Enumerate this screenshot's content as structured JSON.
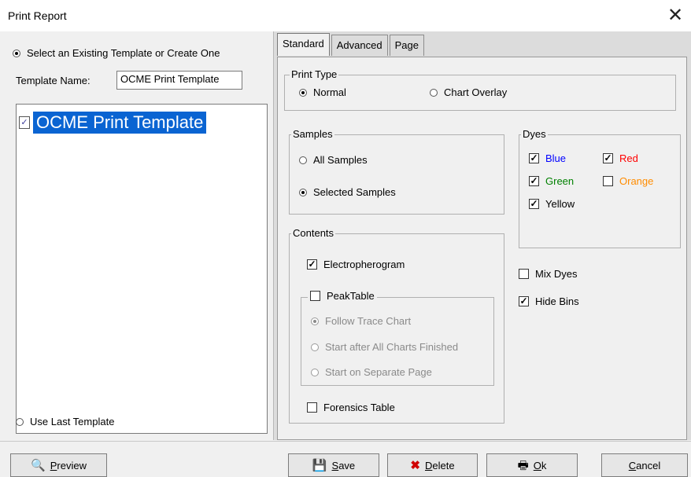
{
  "window": {
    "title": "Print Report",
    "close_glyph": "✕"
  },
  "left": {
    "select_existing_label": "Select an Existing Template or Create One",
    "template_name_label": "Template Name:",
    "template_name_value": "OCME Print Template",
    "template_list": [
      {
        "label": "OCME Print Template",
        "selected": true
      }
    ],
    "use_last_label": "Use Last Template"
  },
  "tabs": [
    "Standard",
    "Advanced",
    "Page"
  ],
  "print_type": {
    "legend": "Print Type",
    "normal": "Normal",
    "chart_overlay": "Chart Overlay"
  },
  "samples": {
    "legend": "Samples",
    "all": "All Samples",
    "selected": "Selected Samples"
  },
  "dyes": {
    "legend": "Dyes",
    "items": [
      {
        "label": "Blue",
        "checked": true,
        "color": "#0000ff"
      },
      {
        "label": "Red",
        "checked": true,
        "color": "#ff0000"
      },
      {
        "label": "Green",
        "checked": true,
        "color": "#008000"
      },
      {
        "label": "Orange",
        "checked": false,
        "color": "#ff8c00"
      },
      {
        "label": "Yellow",
        "checked": true,
        "color": "#000000"
      }
    ]
  },
  "contents": {
    "legend": "Contents",
    "electropherogram": "Electropherogram",
    "peaktable": "PeakTable",
    "follow_trace": "Follow Trace Chart",
    "start_after": "Start after All Charts Finished",
    "start_separate": "Start on Separate Page",
    "forensics": "Forensics Table"
  },
  "options": {
    "mix_dyes": "Mix Dyes",
    "hide_bins": "Hide Bins"
  },
  "buttons": {
    "preview": {
      "accel": "P",
      "rest": "review"
    },
    "save": {
      "accel": "S",
      "rest": "ave"
    },
    "delete": {
      "accel": "D",
      "rest": "elete"
    },
    "ok": {
      "accel": "O",
      "rest": "k"
    },
    "cancel": {
      "accel": "C",
      "rest": "ancel"
    }
  },
  "colors": {
    "selection": "#0a64d2",
    "dialog_bg": "#f0f0f0"
  },
  "icons": {
    "template_item": "document-check-icon",
    "preview": "magnifier-page-icon",
    "save": "floppy-disk-icon",
    "delete": "red-x-icon",
    "ok": "printer-icon"
  }
}
